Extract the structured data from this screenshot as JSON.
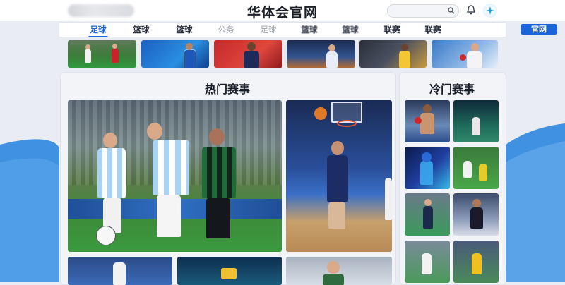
{
  "header": {
    "site_title": "华体会官网",
    "icons": [
      "search-icon",
      "bell-icon",
      "sparkle-icon"
    ]
  },
  "nav": {
    "items": [
      {
        "label": "足球"
      },
      {
        "label": "篮球"
      },
      {
        "label": "篮球"
      },
      {
        "label": "公务"
      },
      {
        "label": "足球"
      },
      {
        "label": "篮球"
      },
      {
        "label": "篮球"
      },
      {
        "label": "联赛"
      },
      {
        "label": "联赛"
      }
    ],
    "button_label": "官网"
  },
  "sections": {
    "hot_title": "热门赛事",
    "cold_title": "冷门赛事"
  },
  "colors": {
    "accent": "#1a63d8",
    "page_bg": "#e9edf3",
    "panel_bg": "#f3f4f7"
  }
}
